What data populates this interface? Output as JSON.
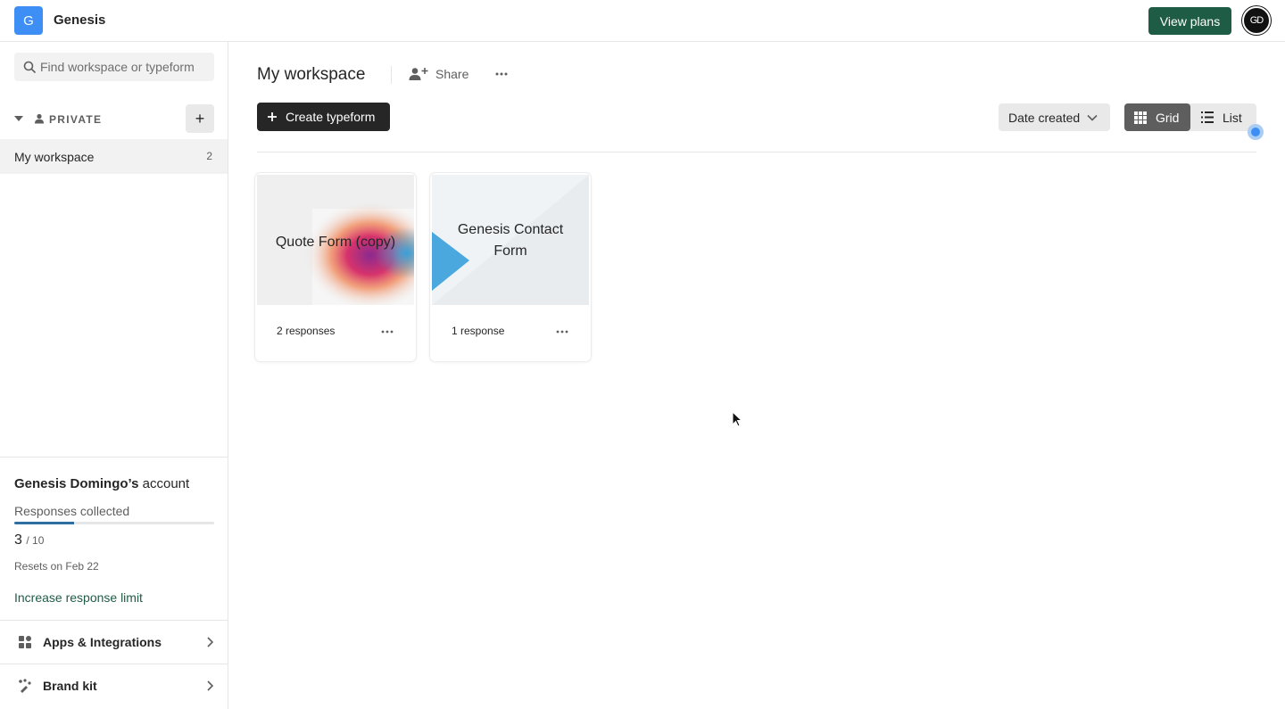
{
  "topbar": {
    "org_initial": "G",
    "org_name": "Genesis",
    "view_plans_label": "View plans",
    "avatar_initials": "GD"
  },
  "sidebar": {
    "search_placeholder": "Find workspace or typeform",
    "section_label": "PRIVATE",
    "add_label": "+",
    "workspaces": [
      {
        "label": "My workspace",
        "count": "2"
      }
    ],
    "account": {
      "owner": "Genesis Domingo’s",
      "suffix": " account",
      "responses_label": "Responses collected",
      "responses_used": "3",
      "responses_max": "/ 10",
      "responses_fraction": 0.3,
      "resets": "Resets on Feb 22",
      "increase_link": "Increase response limit"
    },
    "links": [
      {
        "label": "Apps & Integrations"
      },
      {
        "label": "Brand kit"
      }
    ]
  },
  "main": {
    "title": "My workspace",
    "share_label": "Share",
    "create_label": "Create typeform",
    "sort_label": "Date created",
    "view_grid_label": "Grid",
    "view_list_label": "List",
    "active_view": "grid",
    "forms": [
      {
        "title": "Quote Form (copy)",
        "responses": "2 responses"
      },
      {
        "title_line1": "Genesis Contact",
        "title_line2": "Form",
        "responses": "1 response"
      }
    ]
  },
  "colors": {
    "accent_green": "#1f5c45",
    "brand_blue": "#3d8ef5",
    "progress_blue": "#2d6ea3"
  }
}
